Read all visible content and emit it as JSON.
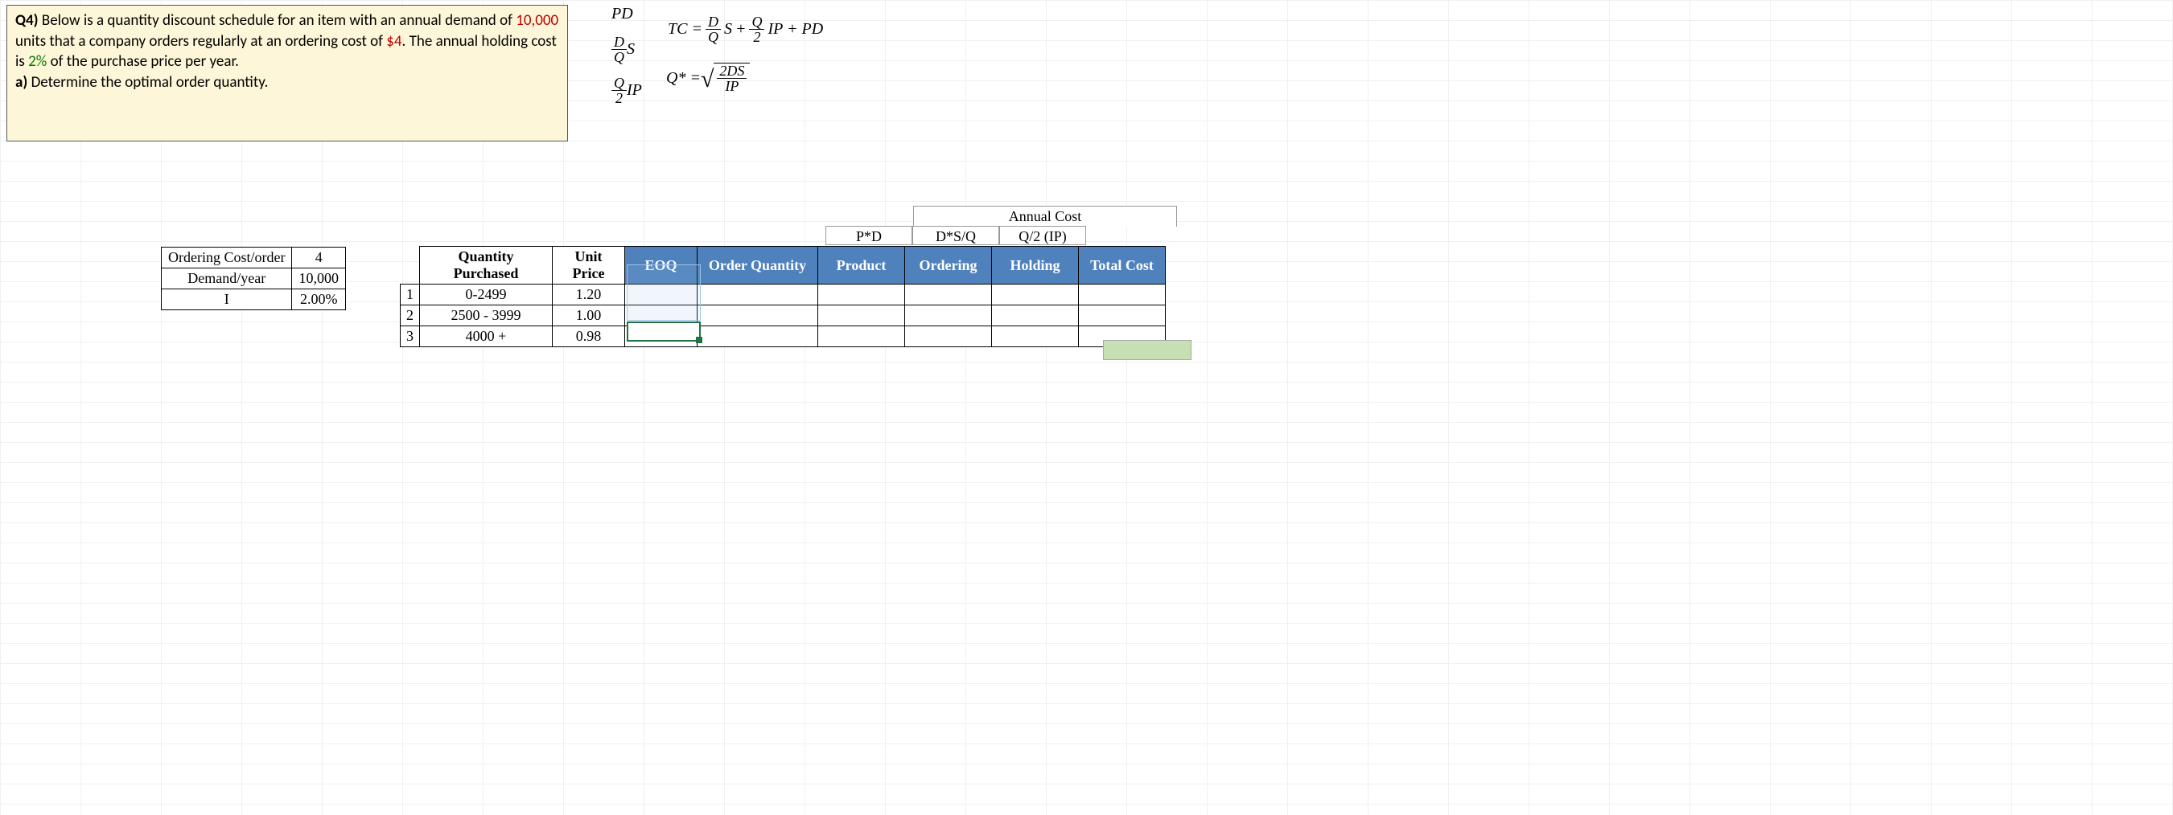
{
  "question": {
    "label": "Q4)",
    "text_before_demand": " Below is a quantity discount schedule for an item with an annual demand of ",
    "demand": "10,000",
    "text_after_demand": " units that a company orders regularly at an ordering cost of ",
    "ordering_cost": "$4",
    "text_after_cost": ".  The annual holding cost is ",
    "holding_pct": "2%",
    "text_after_pct": " of the purchase price per year.",
    "part_a_label": "a)",
    "part_a_text": " Determine the optimal order quantity."
  },
  "formulas": {
    "pd": "PD",
    "ds_q_top": "D",
    "ds_q_bot": "Q",
    "ds_q_tail": "S",
    "qip_top": "Q",
    "qip_bot": "2",
    "qip_tail": "IP",
    "tc_lhs": "TC =",
    "tc_plus": "+",
    "tc_tail": "IP + PD",
    "qstar_lhs": "Q* =",
    "qstar_top": "2DS",
    "qstar_bot": "IP"
  },
  "params": {
    "rows": [
      {
        "label": "Ordering Cost/order",
        "value": "4"
      },
      {
        "label": "Demand/year",
        "value": "10,000"
      },
      {
        "label": "I",
        "value": "2.00%"
      }
    ]
  },
  "cost_hdr": {
    "annual": "Annual Cost",
    "pd": "P*D",
    "dsq": "D*S/Q",
    "q2ip": "Q/2 (IP)"
  },
  "main": {
    "headers": {
      "qty": "Quantity Purchased",
      "price": "Unit Price",
      "eoq": "EOQ",
      "oq": "Order Quantity",
      "product": "Product",
      "ordering": "Ordering",
      "holding": "Holding",
      "total": "Total Cost"
    },
    "rows": [
      {
        "idx": "1",
        "qty": "0-2499",
        "price": "1.20"
      },
      {
        "idx": "2",
        "qty": "2500 - 3999",
        "price": "1.00"
      },
      {
        "idx": "3",
        "qty": "4000 +",
        "price": "0.98"
      }
    ]
  }
}
